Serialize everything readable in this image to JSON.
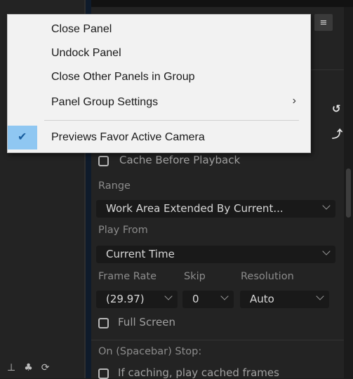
{
  "menu": {
    "items": [
      {
        "label": "Close Panel"
      },
      {
        "label": "Undock Panel"
      },
      {
        "label": "Close Other Panels in Group"
      },
      {
        "label": "Panel Group Settings",
        "submenu": true
      },
      {
        "label": "Previews Favor Active Camera",
        "checked": true
      }
    ],
    "submenu_glyph": "›",
    "check_glyph": "✔"
  },
  "panel": {
    "cache_before_playback": {
      "label": "Cache Before Playback",
      "checked": false
    },
    "range": {
      "label": "Range",
      "value": "Work Area Extended By Current..."
    },
    "play_from": {
      "label": "Play From",
      "value": "Current Time"
    },
    "frame_rate": {
      "label": "Frame Rate",
      "value": "(29.97)"
    },
    "skip": {
      "label": "Skip",
      "value": "0"
    },
    "resolution": {
      "label": "Resolution",
      "value": "Auto"
    },
    "full_screen": {
      "label": "Full Screen",
      "checked": false
    },
    "on_stop": {
      "label": "On (Spacebar) Stop:"
    },
    "if_caching": {
      "label": "If caching, play cached frames",
      "checked": false
    }
  },
  "icons": {
    "hamburger": "≡",
    "reset": "↺",
    "export": "⤴",
    "bottom": [
      "⊥",
      "♣",
      "⟳"
    ]
  },
  "colors": {
    "menu_bg": "#f2f2f2",
    "check_highlight": "#8fc7f2",
    "panel_bg": "#232323"
  }
}
